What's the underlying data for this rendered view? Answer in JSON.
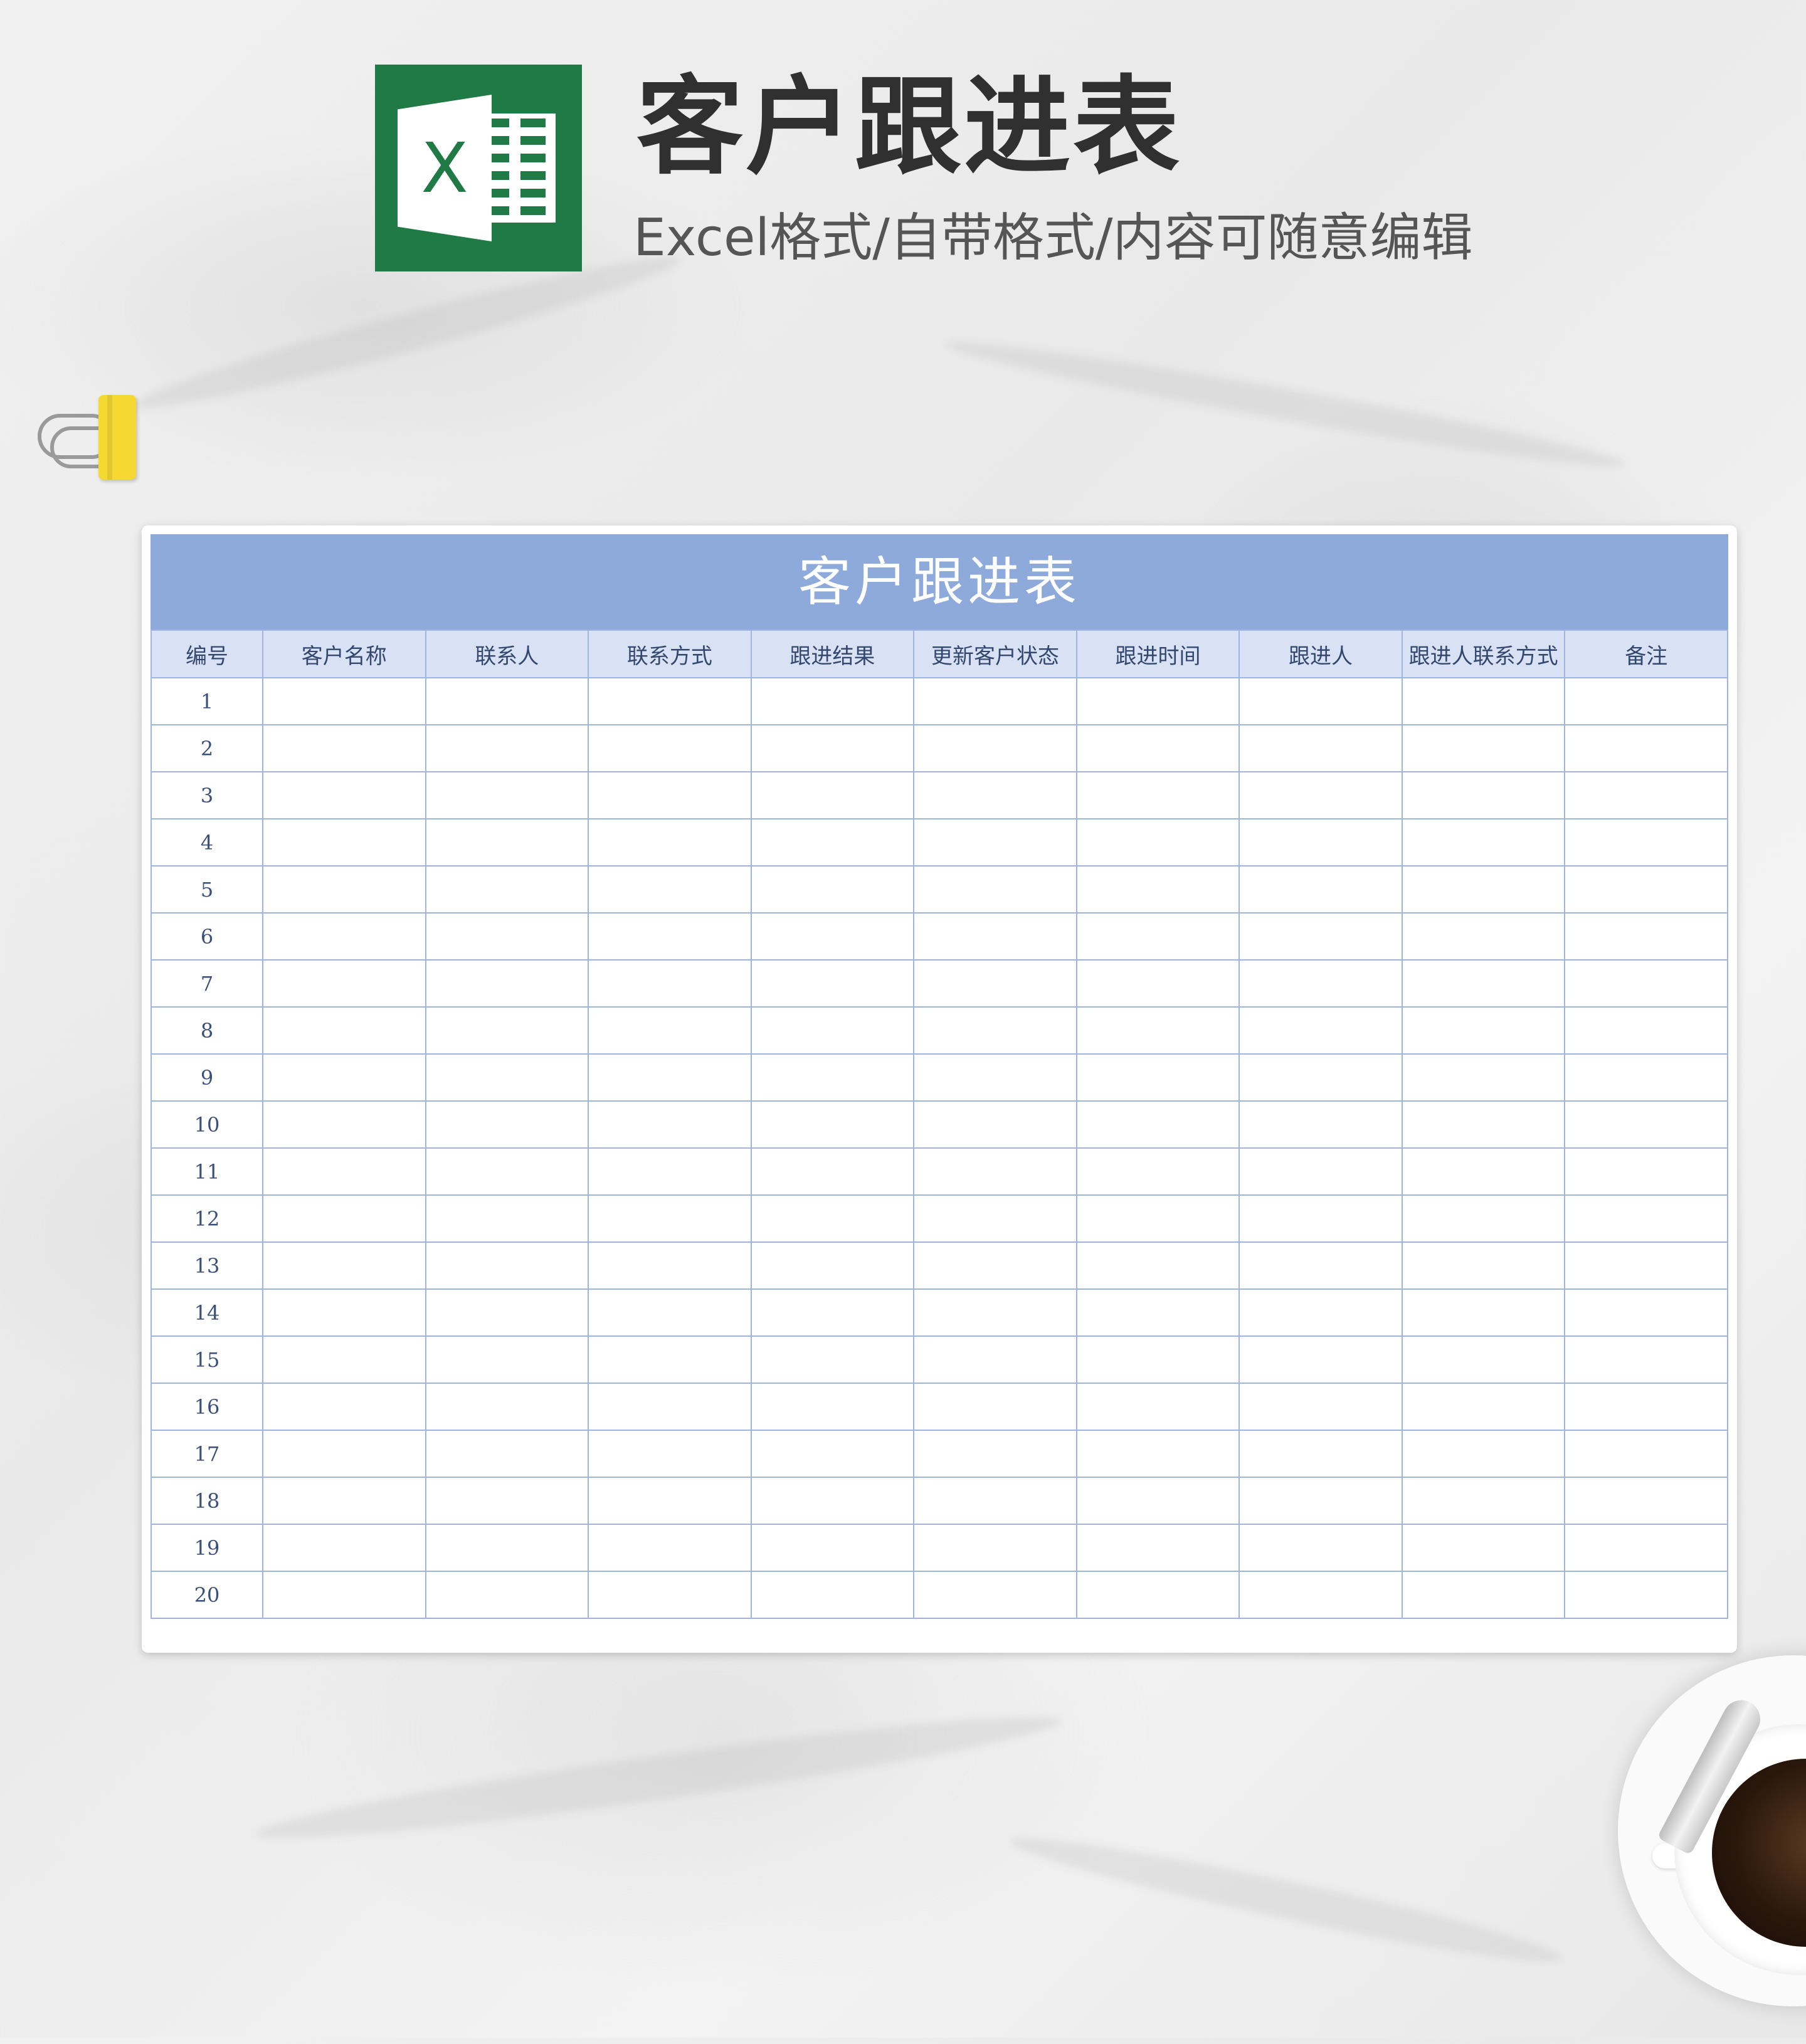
{
  "header": {
    "title": "客户跟进表",
    "subtitle": "Excel格式/自带格式/内容可随意编辑",
    "logo_letter": "X"
  },
  "table": {
    "title": "客户跟进表",
    "columns": [
      "编号",
      "客户名称",
      "联系人",
      "联系方式",
      "跟进结果",
      "更新客户状态",
      "跟进时间",
      "跟进人",
      "跟进人联系方式",
      "备注"
    ],
    "rows": [
      "1",
      "2",
      "3",
      "4",
      "5",
      "6",
      "7",
      "8",
      "9",
      "10",
      "11",
      "12",
      "13",
      "14",
      "15",
      "16",
      "17",
      "18",
      "19",
      "20"
    ]
  },
  "colors": {
    "title_bar": "#8eaadb",
    "header_row": "#d9e2f4",
    "grid_line": "#9fb5df",
    "logo_green": "#1f7a45"
  },
  "icons": {
    "logo": "excel-icon",
    "clip": "binder-clip-icon",
    "coffee": "coffee-cup-icon"
  }
}
